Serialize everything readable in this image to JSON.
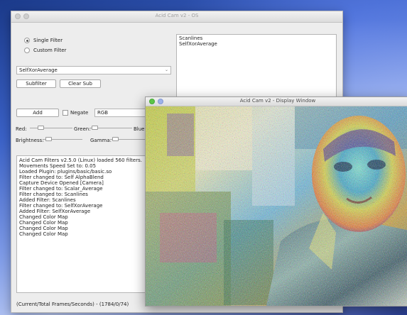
{
  "main_window": {
    "title": "Acid Cam v2 - OS",
    "radios": [
      {
        "label": "Single Filter",
        "selected": true
      },
      {
        "label": "Custom Filter",
        "selected": false
      }
    ],
    "filter_select": {
      "value": "SelfXorAverage",
      "chevron": "⌄"
    },
    "subfilter_label": "Subfilter",
    "clear_sub_label": "Clear Sub",
    "add_label": "Add",
    "negate_label": "Negate",
    "color_mode": "RGB",
    "slider_labels": {
      "red": "Red:",
      "green": "Green:",
      "blue": "Blue:",
      "brightness": "Brightness:",
      "gamma": "Gamma:"
    },
    "custom_list": [
      "Scanlines",
      "SelfXorAverage"
    ],
    "log_lines": [
      "Acid Cam Filters v2.5.0 (Linux) loaded 560 filters.",
      "Movements Speed Set to: 0.05",
      "Loaded Plugin: plugins/basic/basic.so",
      "Filter changed to: Self AlphaBlend",
      "Capture Device Opened [Camera]",
      "Filter changed to: Scalar_Average",
      "Filter changed to: Scanlines",
      "Added Filter: Scanlines",
      "Filter changed to: SelfXorAverage",
      "Added Filter: SelfXorAverage",
      "Changed Color Map",
      "Changed Color Map",
      "Changed Color Map",
      "Changed Color Map"
    ],
    "status": "(Current/Total Frames/Seconds) - (1784/0/74)"
  },
  "display_window": {
    "title": "Acid Cam v2 - Display Window"
  },
  "colors": {
    "traffic_green": "#5cc548",
    "traffic_blue": "#9db2e8",
    "window_bg": "#ededed",
    "desktop_blue": "#3b62c8"
  }
}
